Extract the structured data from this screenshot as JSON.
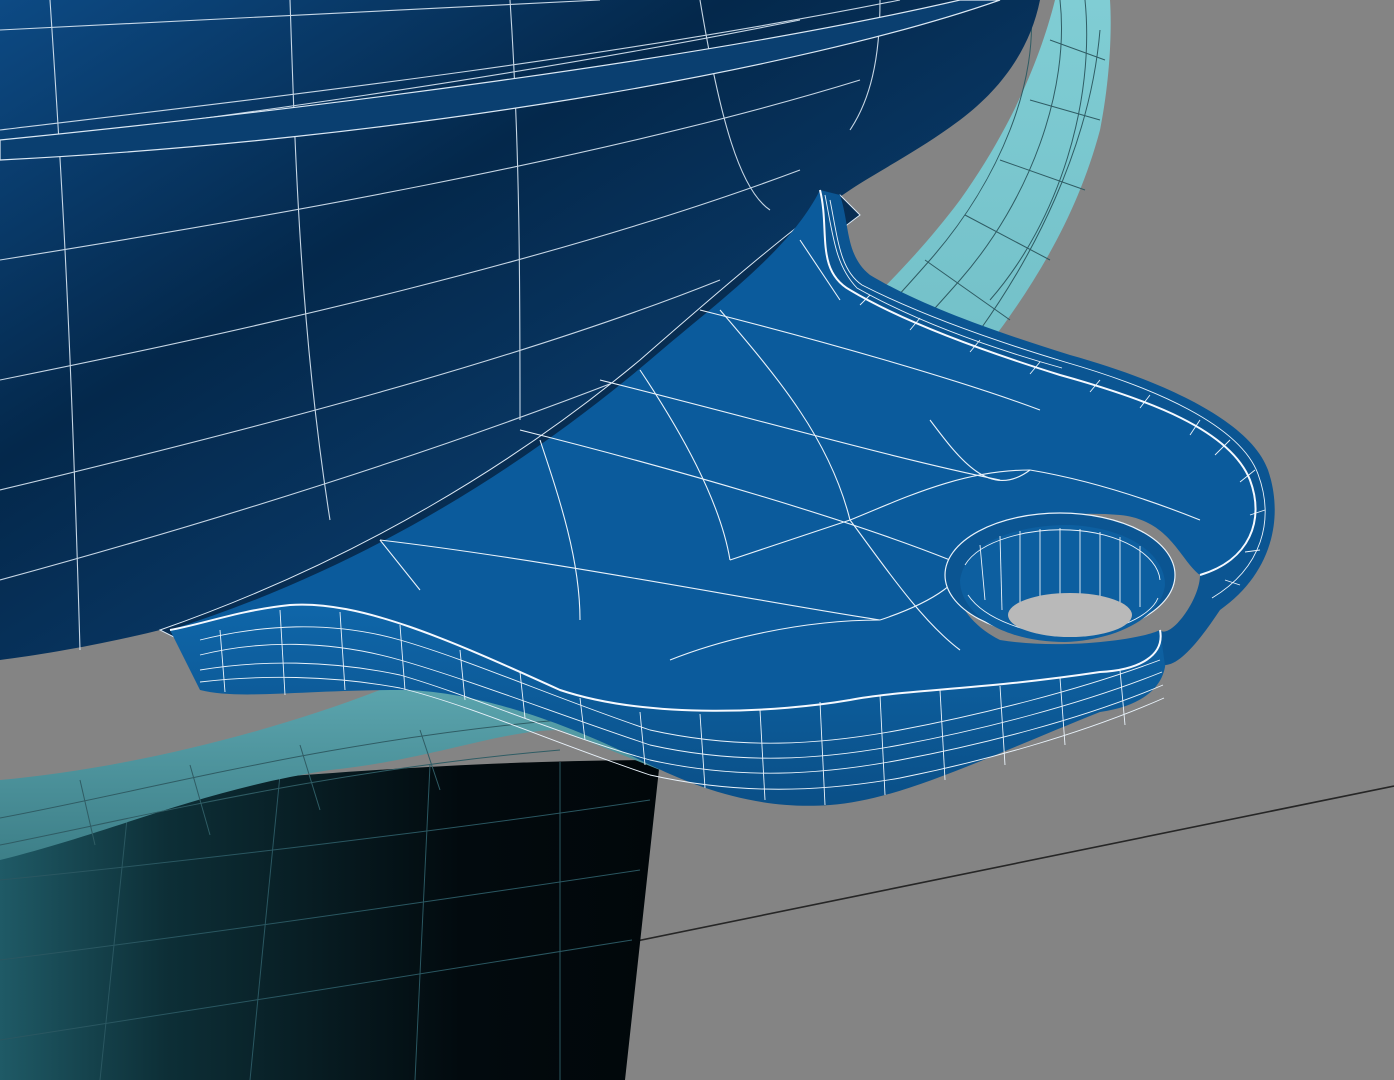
{
  "viewport": {
    "background": "#848484",
    "grid_line_color": "#262626",
    "wire_color": "#e9f2fa",
    "wire_color_dark": "#1f3238"
  },
  "model": {
    "body_color_dark": "#03223f",
    "body_color_mid": "#0b3f73",
    "rim_color": "#0c5896",
    "lip_color": "#7bc7cf",
    "lip_shadow": "#3f8590",
    "base_color_dark": "#030b10",
    "base_color_mid": "#174a54",
    "hole_color": "#b5b5b5"
  }
}
